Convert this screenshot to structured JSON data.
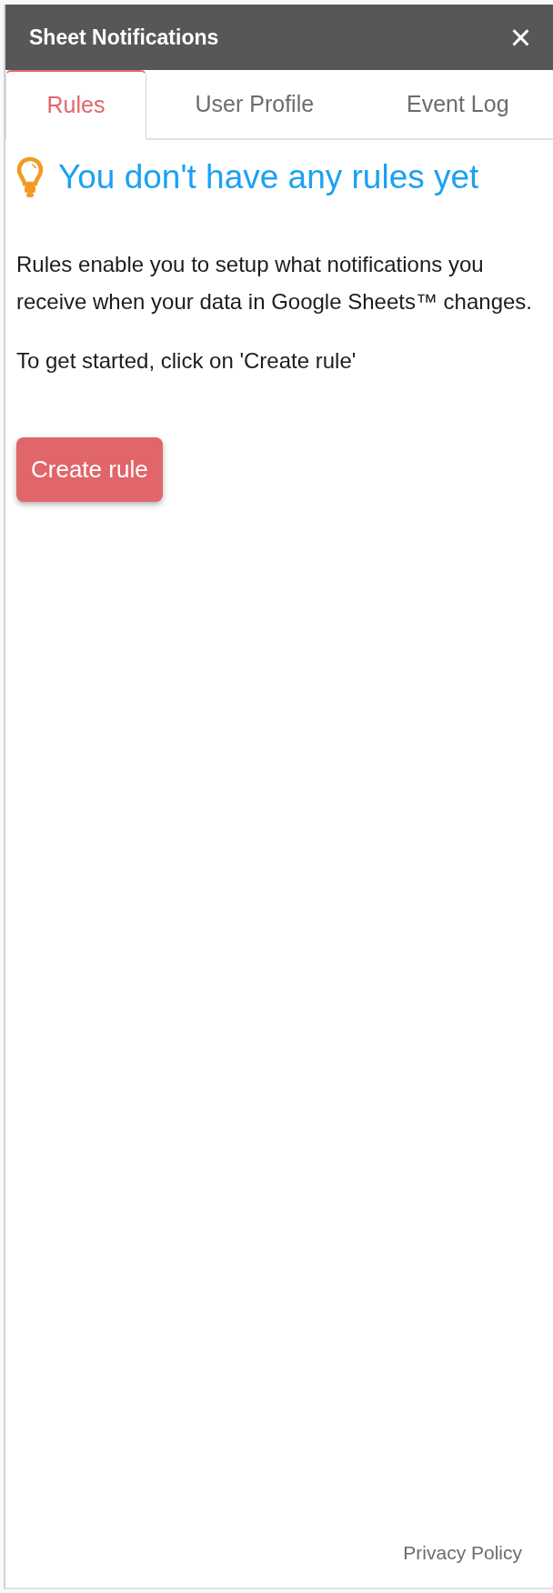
{
  "window": {
    "title": "Sheet Notifications",
    "close": "×"
  },
  "tabs": [
    {
      "label": "Rules",
      "selected": true
    },
    {
      "label": "User Profile",
      "selected": false
    },
    {
      "label": "Event Log",
      "selected": false
    }
  ],
  "empty_state": {
    "heading": "You don't have any rules yet",
    "paragraphs": [
      "Rules enable you to setup what notifications you receive when your data in Google Sheets™ changes.",
      "To get started, click on 'Create rule'"
    ],
    "button": "Create rule"
  },
  "footer": {
    "link": "Privacy Policy"
  }
}
